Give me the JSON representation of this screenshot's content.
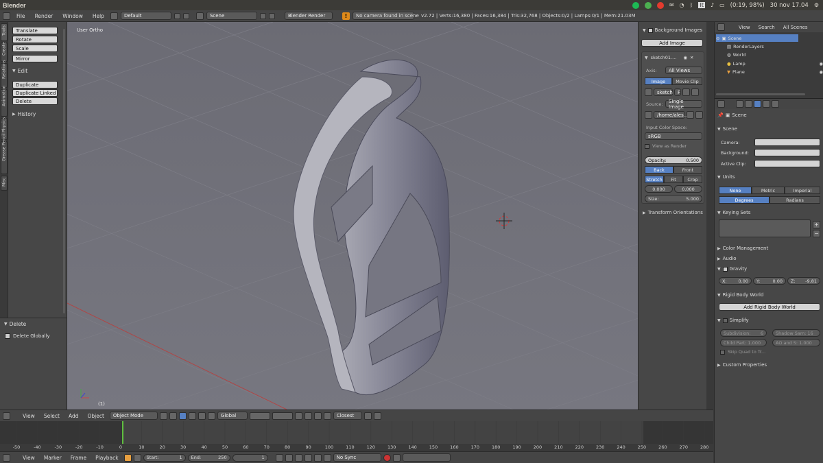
{
  "system_bar": {
    "app_name": "Blender",
    "battery": "(0:19, 98%)",
    "clock": "30 nov 17.04"
  },
  "info_header": {
    "menus": [
      "File",
      "Render",
      "Window",
      "Help"
    ],
    "layout": "Default",
    "scene": "Scene",
    "engine": "Blender Render",
    "warning": "No camera found in scene",
    "stats": "v2.72 | Verts:16,380 | Faces:16,384 | Tris:32,768 | Objects:0/2 | Lamps:0/1 | Mem:21.03M"
  },
  "left_tabs": [
    "Tools",
    "Create",
    "Relations",
    "Animation",
    "Physics",
    "Grease Pencil",
    "Misc"
  ],
  "tool_shelf": {
    "transform_buttons": [
      "Translate",
      "Rotate",
      "Scale"
    ],
    "mirror": "Mirror",
    "edit_header": "Edit",
    "edit_buttons": [
      "Duplicate",
      "Duplicate Linked",
      "Delete"
    ],
    "history_header": "History"
  },
  "operator_panel": {
    "header": "Delete",
    "option": "Delete Globally"
  },
  "viewport": {
    "view_label": "User Ortho",
    "frame_label": "(1)"
  },
  "n_panel": {
    "background_images_header": "Background Images",
    "add_image": "Add Image",
    "image_name": "sketch01....",
    "axis_label": "Axis:",
    "axis_value": "All Views",
    "tab_image": "Image",
    "tab_movie_clip": "Movie Clip",
    "image_block": "sketch",
    "image_block_flag": "F",
    "source_label": "Source:",
    "source_value": "Single Image",
    "filepath": "/home/ales...",
    "color_space_label": "Input Color Space:",
    "color_space_value": "sRGB",
    "view_as_render": "View as Render",
    "opacity_label": "Opacity:",
    "opacity_value": "0.500",
    "back": "Back",
    "front": "Front",
    "stretch": "Stretch",
    "fit": "Fit",
    "crop": "Crop",
    "offset_x": "0.000",
    "offset_y": "0.000",
    "size_label": "Size:",
    "size_value": "5.000",
    "transform_orientations": "Transform Orientations"
  },
  "outliner": {
    "menus": [
      "View",
      "Search",
      "All Scenes"
    ],
    "items": [
      "Scene",
      "RenderLayers",
      "World",
      "Lamp",
      "Plane"
    ]
  },
  "properties": {
    "context": "Scene",
    "scene_header": "Scene",
    "camera_label": "Camera:",
    "background_label": "Background:",
    "active_clip_label": "Active Clip:",
    "units_header": "Units",
    "unit_none": "None",
    "unit_metric": "Metric",
    "unit_imperial": "Imperial",
    "degrees": "Degrees",
    "radians": "Radians",
    "keying_sets_header": "Keying Sets",
    "color_management": "Color Management",
    "audio": "Audio",
    "gravity": "Gravity",
    "gravity_x": "X:",
    "gravity_x_val": "0.00",
    "gravity_y": "Y:",
    "gravity_y_val": "0.00",
    "gravity_z": "Z:",
    "gravity_z_val": "-9.81",
    "rigid_body_world": "Rigid Body World",
    "add_rigid_body_world": "Add Rigid Body World",
    "simplify": "Simplify",
    "subdivision": "Subdivision:",
    "subdivision_val": "6",
    "shadow_samples": "Shadow Sam: 16",
    "child_particles": "Child Part: 1.000",
    "ao_sss": "AO and S: 1.000",
    "skip_quad": "Skip Quad to Tr...",
    "custom_properties": "Custom Properties"
  },
  "view3d_header": {
    "menus": [
      "View",
      "Select",
      "Add",
      "Object"
    ],
    "mode": "Object Mode",
    "orientation": "Global",
    "snap": "Closest"
  },
  "timeline": {
    "ticks": [
      "-50",
      "-40",
      "-30",
      "-20",
      "-10",
      "0",
      "10",
      "20",
      "30",
      "40",
      "50",
      "60",
      "70",
      "80",
      "90",
      "100",
      "110",
      "120",
      "130",
      "140",
      "150",
      "160",
      "170",
      "180",
      "190",
      "200",
      "210",
      "220",
      "230",
      "240",
      "250",
      "260",
      "270",
      "280"
    ],
    "menus": [
      "View",
      "Marker",
      "Frame",
      "Playback"
    ],
    "start_label": "Start:",
    "start_val": "1",
    "end_label": "End:",
    "end_val": "250",
    "current": "1",
    "sync": "No Sync"
  }
}
